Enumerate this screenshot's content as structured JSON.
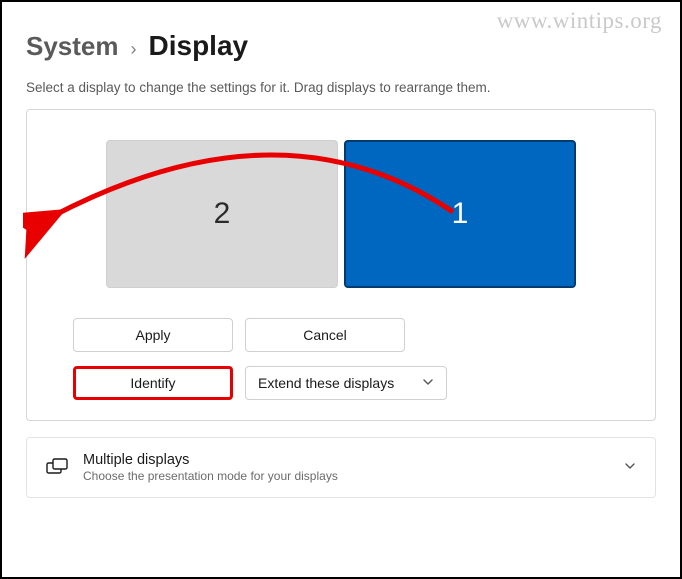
{
  "watermark": "www.wintips.org",
  "breadcrumb": {
    "parent": "System",
    "current": "Display"
  },
  "subtitle": "Select a display to change the settings for it. Drag displays to rearrange them.",
  "displays": {
    "monitor2_label": "2",
    "monitor1_label": "1"
  },
  "buttons": {
    "apply": "Apply",
    "cancel": "Cancel",
    "identify": "Identify"
  },
  "dropdown": {
    "selected": "Extend these displays"
  },
  "section": {
    "title": "Multiple displays",
    "desc": "Choose the presentation mode for your displays"
  },
  "colors": {
    "accent": "#0067c0",
    "highlight": "#e80000"
  }
}
